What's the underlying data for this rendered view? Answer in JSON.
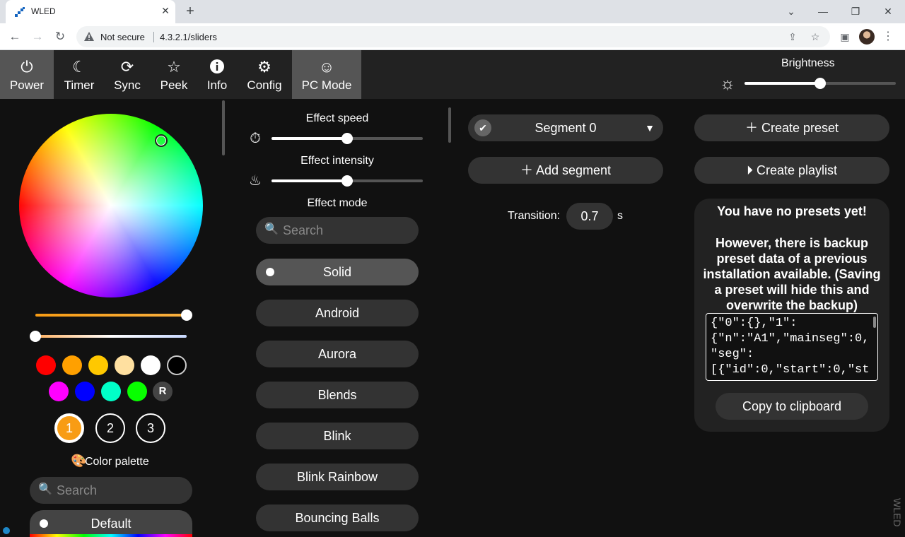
{
  "browser": {
    "tab_title": "WLED",
    "new_tab_symbol": "+",
    "security_label": "Not secure",
    "url": "4.3.2.1/sliders"
  },
  "topbar": {
    "buttons": [
      {
        "label": "Power",
        "icon": "power-icon",
        "active": true
      },
      {
        "label": "Timer",
        "icon": "moon-icon",
        "active": false
      },
      {
        "label": "Sync",
        "icon": "sync-icon",
        "active": false
      },
      {
        "label": "Peek",
        "icon": "star-icon",
        "active": false
      },
      {
        "label": "Info",
        "icon": "info-icon",
        "active": false
      },
      {
        "label": "Config",
        "icon": "gear-icon",
        "active": false
      },
      {
        "label": "PC Mode",
        "icon": "smiley-icon",
        "active": true
      }
    ],
    "brightness_label": "Brightness",
    "brightness_fraction": 0.5
  },
  "colors": {
    "accent": "#f89c14",
    "background": "#111111",
    "panel": "#222222",
    "control": "#333333",
    "wheel_selection": "orange-yellow",
    "hue_slider_fraction": 1.0,
    "white_slider_fraction": 0.0,
    "quick_colors_row1": [
      "#ff0000",
      "#ffa000",
      "#ffc800",
      "#ffe0a0",
      "#ffffff",
      "#000000"
    ],
    "quick_colors_row2": [
      "#ff00ff",
      "#0000ff",
      "#00ffc8",
      "#08ff00"
    ],
    "random_label": "R",
    "slots": [
      "1",
      "2",
      "3"
    ],
    "selected_slot": "1"
  },
  "palette": {
    "title": "Color palette",
    "search_placeholder": "Search",
    "selected": "Default"
  },
  "effects": {
    "speed_label": "Effect speed",
    "speed_fraction": 0.5,
    "intensity_label": "Effect intensity",
    "intensity_fraction": 0.5,
    "mode_label": "Effect mode",
    "search_placeholder": "Search",
    "list": [
      "Solid",
      "Android",
      "Aurora",
      "Blends",
      "Blink",
      "Blink Rainbow",
      "Bouncing Balls"
    ],
    "selected": "Solid"
  },
  "segments": {
    "segment_name": "Segment 0",
    "add_label": "Add segment",
    "transition_label": "Transition:",
    "transition_value": "0.7",
    "transition_unit": "s"
  },
  "presets": {
    "create_preset": "Create preset",
    "create_playlist": "Create playlist",
    "empty_title": "You have no presets yet!",
    "backup_notice": "However, there is backup preset data of a previous installation available. (Saving a preset will hide this and overwrite the backup)",
    "backup_data": "{\"0\":{},\"1\":{\"n\":\"A1\",\"mainseg\":0,\"seg\":[{\"id\":0,\"start\":0,\"st",
    "copy_label": "Copy to clipboard"
  },
  "watermark": "WLED"
}
